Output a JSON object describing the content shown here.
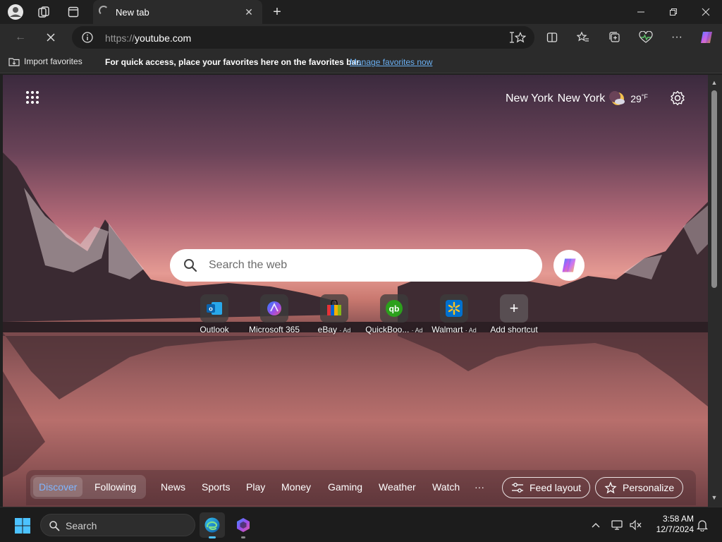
{
  "browser": {
    "tab": {
      "title": "New tab"
    },
    "address": {
      "scheme": "https://",
      "host": "youtube.com"
    },
    "favorites_bar": {
      "import_label": "Import favorites",
      "message": "For quick access, place your favorites here on the favorites bar.",
      "manage_link": "Manage favorites now"
    }
  },
  "newtab": {
    "weather": {
      "city1": "New York",
      "city2": "New York",
      "temp": "29",
      "unit": "°F"
    },
    "search": {
      "placeholder": "Search the web"
    },
    "shortcuts": [
      {
        "label": "Outlook",
        "ad": ""
      },
      {
        "label": "Microsoft 365",
        "ad": ""
      },
      {
        "label": "eBay",
        "ad": "· Ad"
      },
      {
        "label": "QuickBoo...",
        "ad": "· Ad"
      },
      {
        "label": "Walmart",
        "ad": "· Ad"
      },
      {
        "label": "Add shortcut",
        "ad": ""
      }
    ],
    "feed": {
      "discover": "Discover",
      "following": "Following",
      "tabs": [
        "News",
        "Sports",
        "Play",
        "Money",
        "Gaming",
        "Weather",
        "Watch",
        "···"
      ],
      "feed_layout": "Feed layout",
      "personalize": "Personalize"
    }
  },
  "taskbar": {
    "search_label": "Search",
    "time": "3:58 AM",
    "date": "12/7/2024"
  },
  "colors": {
    "accent": "#4cc2ff",
    "link": "#6ab0f3",
    "active_feed": "#7fb6ff"
  }
}
